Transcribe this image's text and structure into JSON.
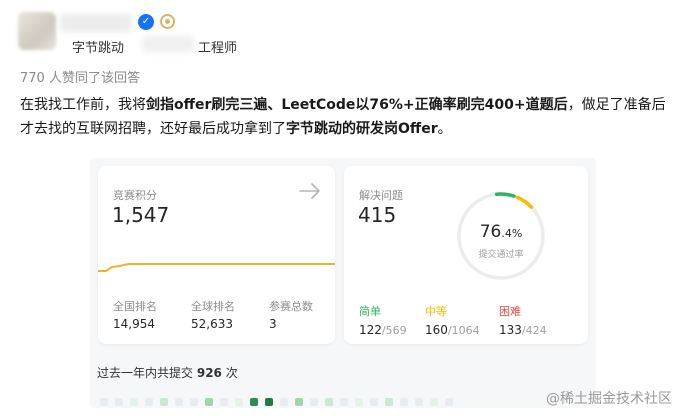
{
  "author": {
    "organization": "字节跳动",
    "role": "工程师",
    "verified_icon": "verified-check-icon",
    "badge_icon": "medal-badge-icon"
  },
  "likes_text": "770 人赞同了该回答",
  "intro": {
    "p1": "在我找工作前，我将",
    "b1": "剑指offer刷完三遍、LeetCode以76%+正确率刷完400+道题后",
    "p2": "，做足了准备后才去找的互联网招聘，还好最后成功拿到了",
    "b2": "字节跳动的研发岗Offer",
    "p3": "。"
  },
  "contest": {
    "label": "竞赛积分",
    "value": "1,547",
    "arrow_icon": "arrow-right-icon",
    "stats": [
      {
        "label": "全国排名",
        "value": "14,954"
      },
      {
        "label": "全球排名",
        "value": "52,633"
      },
      {
        "label": "参赛总数",
        "value": "3"
      }
    ],
    "trend_color": "#f0b429"
  },
  "solve": {
    "label": "解决问题",
    "value": "415",
    "acceptance_pct": "76",
    "acceptance_dec": ".4%",
    "acceptance_caption": "提交通过率",
    "levels": [
      {
        "label": "简单",
        "solved": "122",
        "total": "/569",
        "color": "#2db55d"
      },
      {
        "label": "中等",
        "solved": "160",
        "total": "/1064",
        "color": "#ffb800"
      },
      {
        "label": "困难",
        "solved": "133",
        "total": "/424",
        "color": "#ef4743"
      }
    ]
  },
  "submissions": {
    "prefix": "过去一年内共提交",
    "count": "926",
    "suffix": "次"
  },
  "watermark": "@稀土掘金技术社区"
}
